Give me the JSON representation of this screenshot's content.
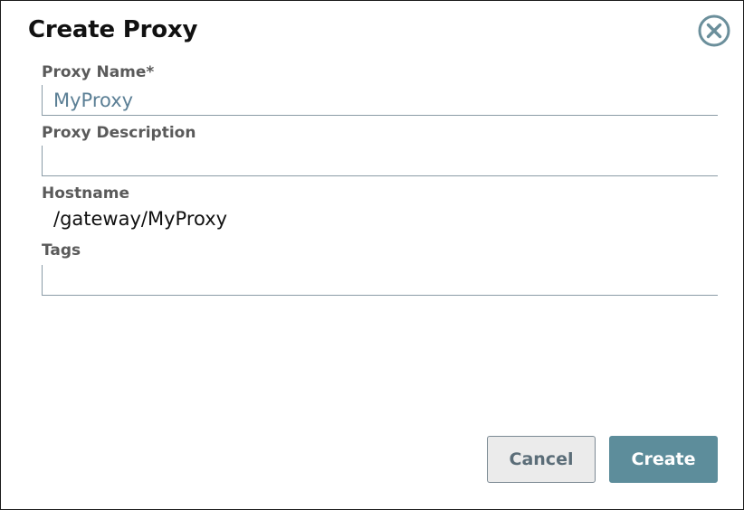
{
  "dialog": {
    "title": "Create Proxy",
    "close_icon": "close-circle-icon"
  },
  "form": {
    "proxy_name": {
      "label": "Proxy Name*",
      "value": "MyProxy"
    },
    "proxy_description": {
      "label": "Proxy Description",
      "value": ""
    },
    "hostname": {
      "label": "Hostname",
      "value": "/gateway/MyProxy"
    },
    "tags": {
      "label": "Tags",
      "value": ""
    }
  },
  "actions": {
    "cancel_label": "Cancel",
    "create_label": "Create"
  },
  "colors": {
    "accent": "#5d8d9b",
    "input_text": "#5b7f95",
    "label_text": "#5a5a5a"
  }
}
